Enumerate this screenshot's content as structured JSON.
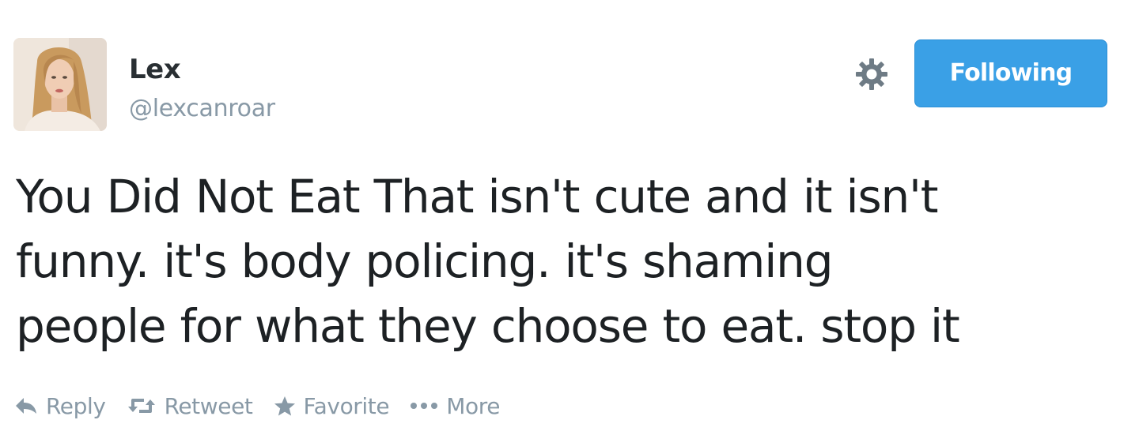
{
  "tweet": {
    "author_name": "Lex",
    "author_handle": "@lexcanroar",
    "follow_button_label": "Following",
    "text_lines": [
      "You Did Not Eat That isn't cute and it isn't",
      "funny. it's body policing. it's shaming",
      "people for what they choose to eat. stop it"
    ],
    "actions": {
      "reply": "Reply",
      "retweet": "Retweet",
      "favorite": "Favorite",
      "more": "More"
    }
  },
  "icons": {
    "settings": "gear-icon",
    "reply": "reply-arrow-icon",
    "retweet": "retweet-icon",
    "favorite": "star-icon",
    "more": "ellipsis-icon"
  },
  "colors": {
    "follow_button": "#3aa0e6",
    "muted_text": "#8899a6",
    "primary_text": "#1d2124"
  }
}
